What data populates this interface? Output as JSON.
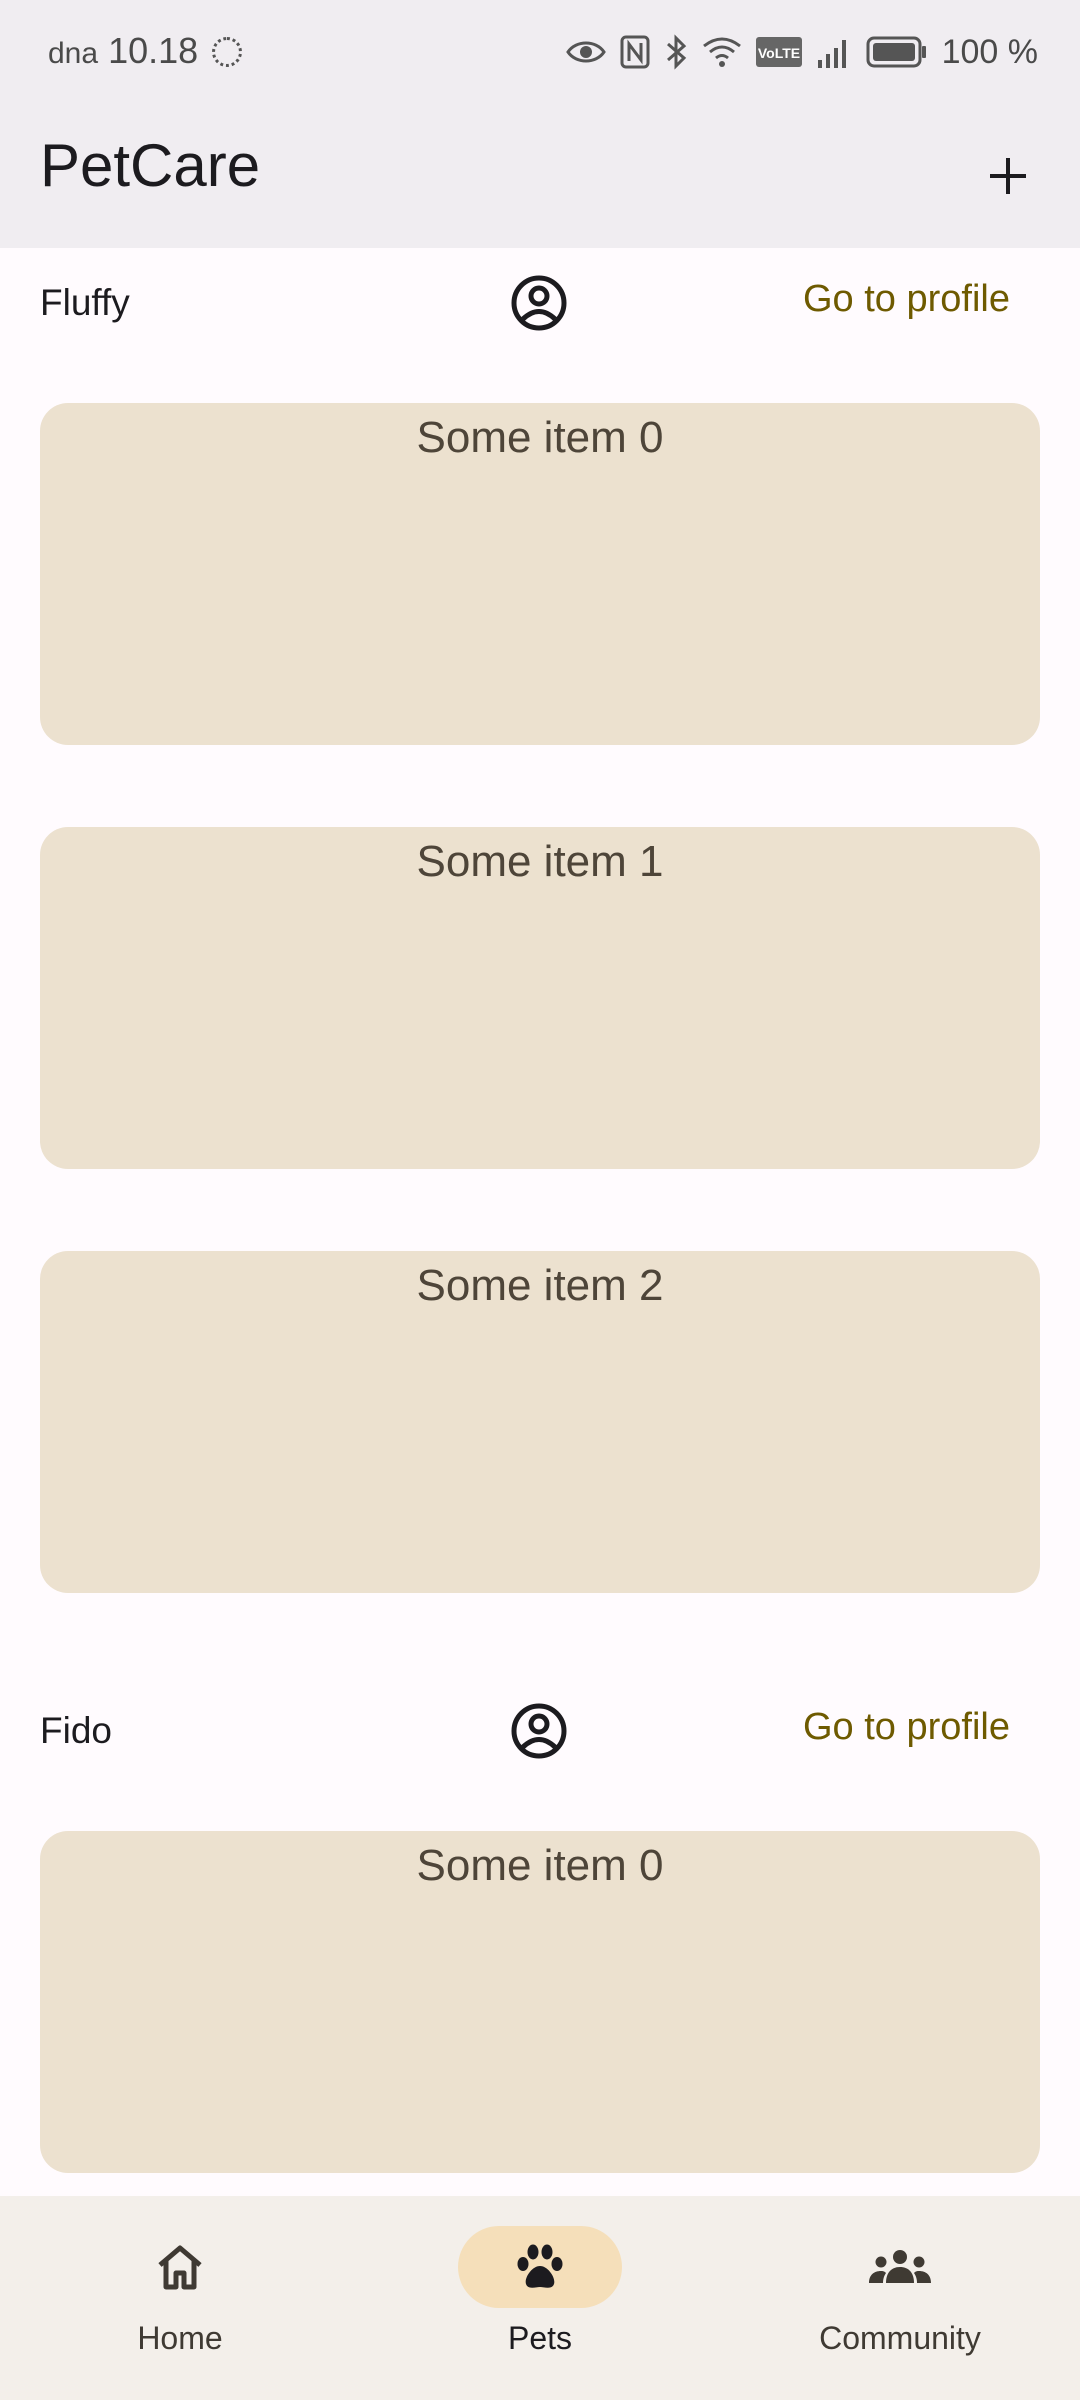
{
  "status_bar": {
    "carrier": "dna",
    "time": "10.18",
    "battery": "100 %",
    "icons": [
      "eye-icon",
      "nfc-icon",
      "bluetooth-icon",
      "wifi-icon",
      "volte-icon",
      "signal-icon",
      "battery-icon"
    ]
  },
  "app_bar": {
    "title": "PetCare",
    "add_icon": "plus-icon"
  },
  "pets": [
    {
      "name": "Fluffy",
      "icon": "account-circle-icon",
      "profile_label": "Go to profile",
      "items": [
        "Some item 0",
        "Some item 1",
        "Some item 2"
      ]
    },
    {
      "name": "Fido",
      "icon": "account-circle-icon",
      "profile_label": "Go to profile",
      "items": [
        "Some item 0"
      ]
    }
  ],
  "bottom_nav": {
    "items": [
      {
        "label": "Home",
        "icon": "home-icon",
        "active": false
      },
      {
        "label": "Pets",
        "icon": "paw-icon",
        "active": true
      },
      {
        "label": "Community",
        "icon": "groups-icon",
        "active": false
      }
    ]
  },
  "colors": {
    "accent": "#6e5a00",
    "card": "#ece1cf",
    "nav_active": "#f5dfba",
    "app_bar": "#f0edf1"
  }
}
